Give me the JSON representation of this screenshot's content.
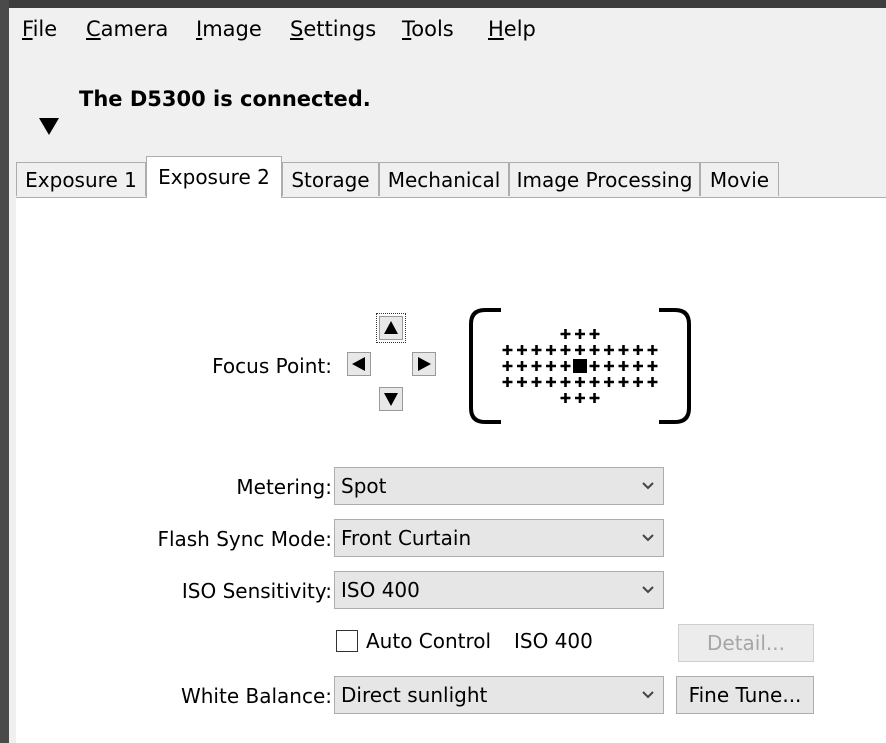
{
  "menu": {
    "items": [
      {
        "pre": "",
        "acc": "F",
        "post": "ile"
      },
      {
        "pre": "",
        "acc": "C",
        "post": "amera"
      },
      {
        "pre": "",
        "acc": "I",
        "post": "mage"
      },
      {
        "pre": "",
        "acc": "S",
        "post": "ettings"
      },
      {
        "pre": "",
        "acc": "T",
        "post": "ools"
      },
      {
        "pre": "",
        "acc": "H",
        "post": "elp"
      }
    ]
  },
  "status": {
    "text": "The D5300 is connected."
  },
  "tabs": [
    {
      "label": "Exposure 1",
      "active": false
    },
    {
      "label": "Exposure 2",
      "active": true
    },
    {
      "label": "Storage",
      "active": false
    },
    {
      "label": "Mechanical",
      "active": false
    },
    {
      "label": "Image Processing",
      "active": false
    },
    {
      "label": "Movie",
      "active": false
    }
  ],
  "focus": {
    "label": "Focus Point:",
    "selected_point": "center"
  },
  "metering": {
    "label": "Metering:",
    "value": "Spot"
  },
  "flash_sync": {
    "label": "Flash Sync Mode:",
    "value": "Front Curtain"
  },
  "iso": {
    "label": "ISO Sensitivity:",
    "value": "ISO 400",
    "auto_control_label": "Auto Control",
    "auto_control_checked": false,
    "auto_value": "ISO 400",
    "detail_label": "Detail..."
  },
  "white_balance": {
    "label": "White Balance:",
    "value": "Direct sunlight",
    "fine_tune_label": "Fine Tune..."
  }
}
